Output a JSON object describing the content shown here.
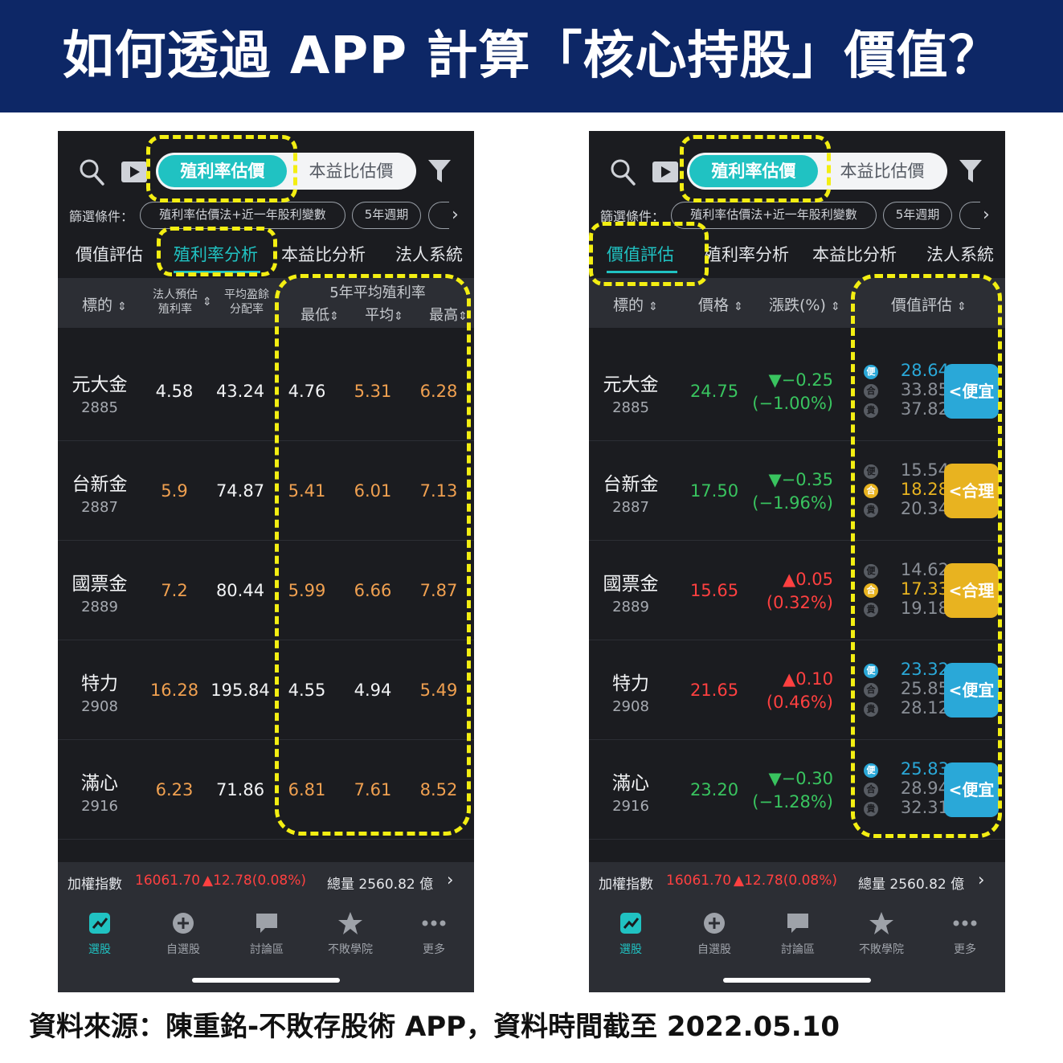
{
  "banner": {
    "title": "如何透過 APP 計算「核心持股」價值？"
  },
  "footer": {
    "source": "資料來源：陳重銘-不敗存股術 APP，資料時間截至 2022.05.10"
  },
  "app": {
    "toolbar": {
      "seg_active": "殖利率估價",
      "seg_inactive": "本益比估價"
    },
    "filter": {
      "label": "篩選條件：",
      "chip1": "殖利率估價法+近一年股利變數",
      "chip2": "5年週期",
      "chip3": ""
    },
    "tabs": [
      "價值評估",
      "殖利率分析",
      "本益比分析",
      "法人系統"
    ],
    "market": {
      "label": "加權指數",
      "index": "16061.70",
      "change": "▲12.78(0.08%)",
      "volume": "總量 2560.82 億"
    },
    "nav": [
      "選股",
      "自選股",
      "討論區",
      "不敗學院",
      "更多"
    ],
    "colors": {
      "accent": "#20c2c2",
      "cheap": "#2aa8d8",
      "fair": "#e8b320",
      "up": "#ff4040",
      "down": "#39c45f",
      "highlight": "#f3ee12"
    }
  },
  "left_screen": {
    "active_tab_index": 1,
    "headers": {
      "stock": "標的",
      "inst_yield_1": "法人預估",
      "inst_yield_2": "殖利率",
      "payout_1": "平均盈餘",
      "payout_2": "分配率",
      "group": "5年平均殖利率",
      "min": "最低",
      "avg": "平均",
      "max": "最高"
    },
    "rows": [
      {
        "name": "元大金",
        "code": "2885",
        "inst_yield": "4.58",
        "payout": "43.24",
        "min": "4.76",
        "avg": "5.31",
        "max": "6.28",
        "yield_orange": false,
        "min_orange": false,
        "avg_orange": true,
        "max_orange": true
      },
      {
        "name": "台新金",
        "code": "2887",
        "inst_yield": "5.9",
        "payout": "74.87",
        "min": "5.41",
        "avg": "6.01",
        "max": "7.13",
        "yield_orange": true,
        "min_orange": true,
        "avg_orange": true,
        "max_orange": true
      },
      {
        "name": "國票金",
        "code": "2889",
        "inst_yield": "7.2",
        "payout": "80.44",
        "min": "5.99",
        "avg": "6.66",
        "max": "7.87",
        "yield_orange": true,
        "min_orange": true,
        "avg_orange": true,
        "max_orange": true
      },
      {
        "name": "特力",
        "code": "2908",
        "inst_yield": "16.28",
        "payout": "195.84",
        "min": "4.55",
        "avg": "4.94",
        "max": "5.49",
        "yield_orange": true,
        "min_orange": false,
        "avg_orange": false,
        "max_orange": true
      },
      {
        "name": "滿心",
        "code": "2916",
        "inst_yield": "6.23",
        "payout": "71.86",
        "min": "6.81",
        "avg": "7.61",
        "max": "8.52",
        "yield_orange": true,
        "min_orange": true,
        "avg_orange": true,
        "max_orange": true
      }
    ]
  },
  "right_screen": {
    "active_tab_index": 0,
    "headers": {
      "stock": "標的",
      "price": "價格",
      "change": "漲跌(%)",
      "valuation": "價值評估"
    },
    "dot_labels": {
      "cheap": "便",
      "fair": "合",
      "expensive": "貴"
    },
    "rows": [
      {
        "name": "元大金",
        "code": "2885",
        "price": "24.75",
        "dir": "down",
        "change": "▼−0.25",
        "pct": "(−1.00%)",
        "cheap": "28.64",
        "fair": "33.85",
        "expensive": "37.82",
        "status": "cheap",
        "badge": "<便宜"
      },
      {
        "name": "台新金",
        "code": "2887",
        "price": "17.50",
        "dir": "down",
        "change": "▼−0.35",
        "pct": "(−1.96%)",
        "cheap": "15.54",
        "fair": "18.28",
        "expensive": "20.34",
        "status": "fair",
        "badge": "<合理"
      },
      {
        "name": "國票金",
        "code": "2889",
        "price": "15.65",
        "dir": "up",
        "change": "▲0.05",
        "pct": "(0.32%)",
        "cheap": "14.62",
        "fair": "17.33",
        "expensive": "19.18",
        "status": "fair",
        "badge": "<合理"
      },
      {
        "name": "特力",
        "code": "2908",
        "price": "21.65",
        "dir": "up",
        "change": "▲0.10",
        "pct": "(0.46%)",
        "cheap": "23.32",
        "fair": "25.85",
        "expensive": "28.12",
        "status": "cheap",
        "badge": "<便宜"
      },
      {
        "name": "滿心",
        "code": "2916",
        "price": "23.20",
        "dir": "down",
        "change": "▼−0.30",
        "pct": "(−1.28%)",
        "cheap": "25.83",
        "fair": "28.94",
        "expensive": "32.31",
        "status": "cheap",
        "badge": "<便宜"
      }
    ]
  }
}
